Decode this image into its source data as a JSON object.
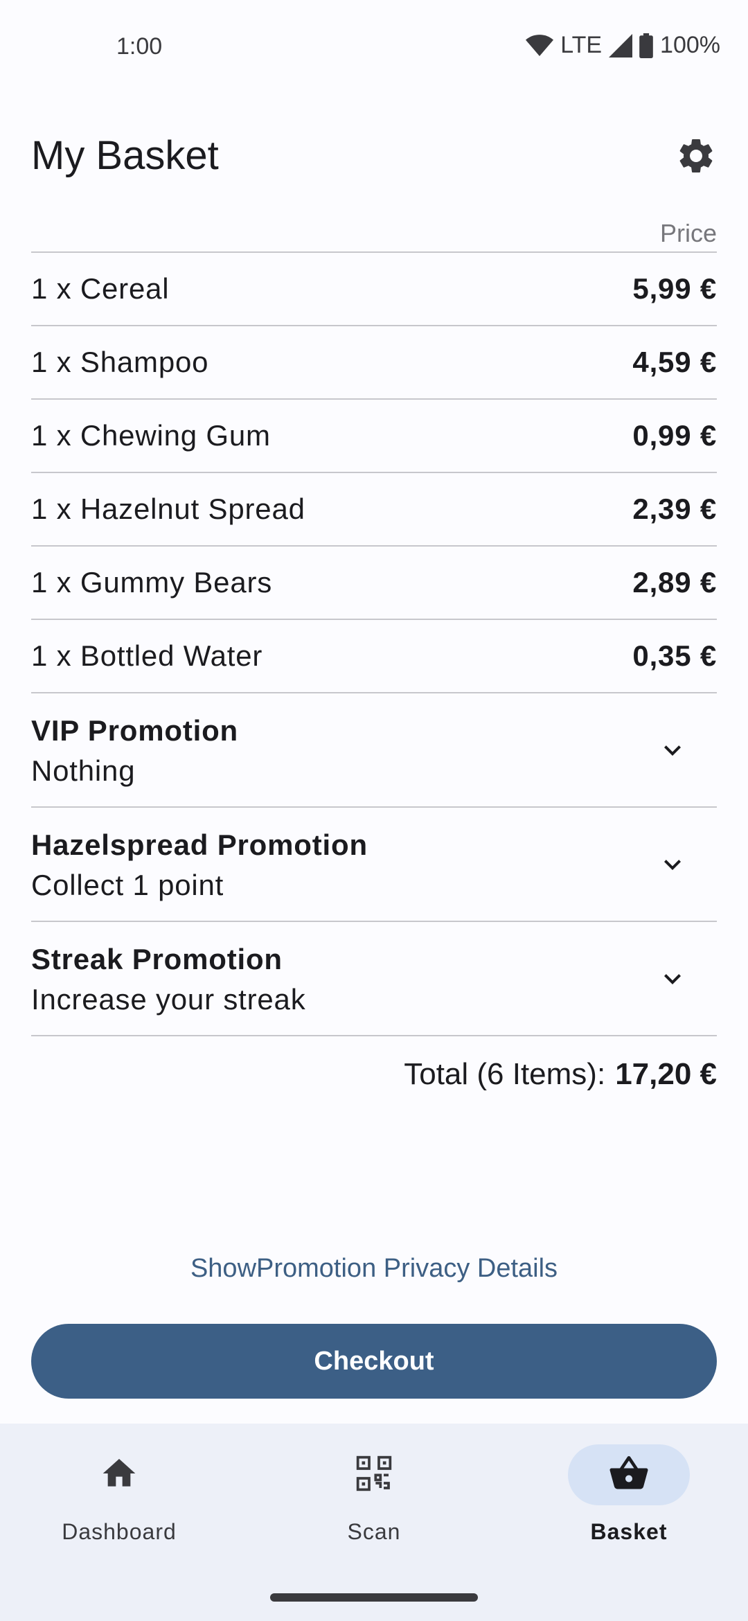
{
  "status_bar": {
    "time": "1:00",
    "network": "LTE",
    "battery": "100%",
    "icons": [
      "wifi-icon",
      "signal-icon",
      "battery-icon"
    ]
  },
  "header": {
    "title": "My Basket",
    "settings_icon": "gear-icon"
  },
  "basket": {
    "price_header": "Price",
    "items": [
      {
        "name": "1 x Cereal",
        "price": "5,99 €"
      },
      {
        "name": "1 x Shampoo",
        "price": "4,59 €"
      },
      {
        "name": "1 x Chewing Gum",
        "price": "0,99 €"
      },
      {
        "name": "1 x Hazelnut Spread",
        "price": "2,39 €"
      },
      {
        "name": "1 x Gummy Bears",
        "price": "2,89 €"
      },
      {
        "name": "1 x Bottled Water",
        "price": "0,35 €"
      }
    ],
    "promotions": [
      {
        "title": "VIP Promotion",
        "subtitle": "Nothing"
      },
      {
        "title": "Hazelspread Promotion",
        "subtitle": "Collect 1 point"
      },
      {
        "title": "Streak Promotion",
        "subtitle": "Increase your streak"
      }
    ],
    "total_label": "Total (6 Items):",
    "total_amount": "17,20 €"
  },
  "privacy_link": "ShowPromotion Privacy Details",
  "checkout_label": "Checkout",
  "bottom_nav": {
    "items": [
      {
        "label": "Dashboard",
        "icon": "home-icon",
        "active": false
      },
      {
        "label": "Scan",
        "icon": "qr-code-icon",
        "active": false
      },
      {
        "label": "Basket",
        "icon": "basket-icon",
        "active": true
      }
    ]
  },
  "colors": {
    "accent": "#3c5f86",
    "nav_background": "#edf0f8",
    "active_pill": "#d6e2f5"
  }
}
